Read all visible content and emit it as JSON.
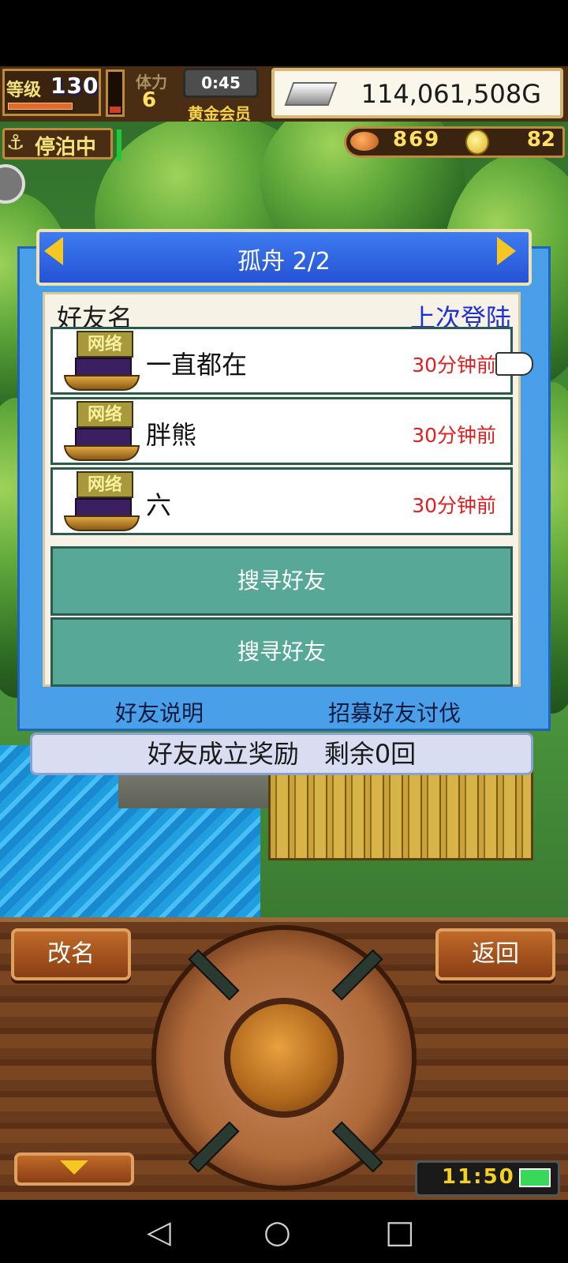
{
  "hud": {
    "level_label": "等级",
    "level_value": "130",
    "stamina_label": "体力",
    "stamina_value": "6",
    "timer": "0:45",
    "membership": "黄金会员",
    "gold": "114,061,508G",
    "status": "停泊中",
    "status_icon": "⚓",
    "food_value": "869",
    "coin_value": "82"
  },
  "dialog": {
    "title": "孤舟 2/2",
    "col_name": "好友名",
    "col_last_login": "上次登陆",
    "friends": [
      {
        "tag": "网络",
        "name": "一直都在",
        "last_login": "30分钟前"
      },
      {
        "tag": "网络",
        "name": "胖熊",
        "last_login": "30分钟前"
      },
      {
        "tag": "网络",
        "name": "六",
        "last_login": "30分钟前"
      }
    ],
    "search_slots": [
      "搜寻好友",
      "搜寻好友"
    ],
    "link_explain": "好友说明",
    "link_recruit": "招募好友讨伐",
    "reward_banner": "好友成立奖励　剩余0回"
  },
  "controls": {
    "rename": "改名",
    "back": "返回",
    "clock": "11:50"
  },
  "navbar": {
    "back_icon": "◁",
    "home_icon": "○",
    "recents_icon": "□"
  },
  "colors": {
    "dialog_blue": "#4aa0e8",
    "title_blue": "#2552d4",
    "search_teal": "#57a896",
    "login_time_red": "#e02020",
    "header_blue_text": "#1e2ed8",
    "panel_wood": "#6a3a1c"
  }
}
